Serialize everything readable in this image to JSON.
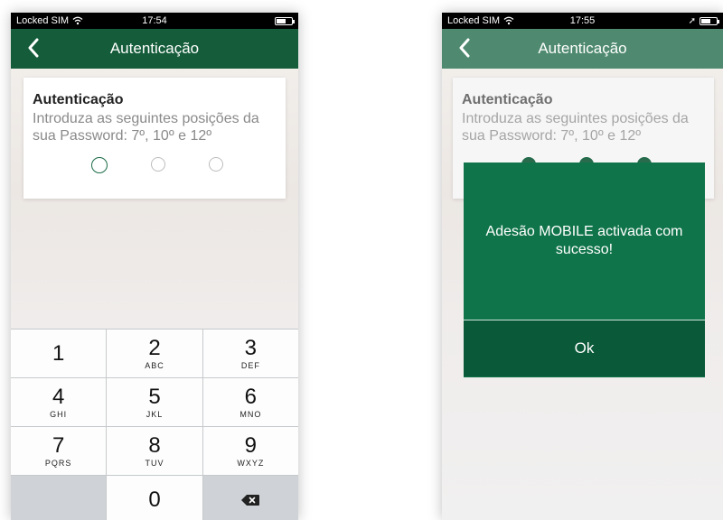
{
  "left_screen": {
    "status": {
      "carrier": "Locked SIM",
      "time": "17:54",
      "wifi_icon": "wifi-icon",
      "battery_icon": "battery-icon"
    },
    "nav": {
      "title": "Autenticação",
      "back_icon": "chevron-left-icon"
    },
    "card": {
      "title": "Autenticação",
      "text": "Introduza as seguintes posições da sua Password: 7º, 10º e 12º",
      "positions": 3,
      "active_position": 1
    },
    "keypad": {
      "keys": [
        {
          "digit": "1",
          "letters": ""
        },
        {
          "digit": "2",
          "letters": "ABC"
        },
        {
          "digit": "3",
          "letters": "DEF"
        },
        {
          "digit": "4",
          "letters": "GHI"
        },
        {
          "digit": "5",
          "letters": "JKL"
        },
        {
          "digit": "6",
          "letters": "MNO"
        },
        {
          "digit": "7",
          "letters": "PQRS"
        },
        {
          "digit": "8",
          "letters": "TUV"
        },
        {
          "digit": "9",
          "letters": "WXYZ"
        },
        {
          "digit": "",
          "letters": ""
        },
        {
          "digit": "0",
          "letters": ""
        }
      ],
      "delete_icon": "backspace-icon"
    }
  },
  "right_screen": {
    "status": {
      "carrier": "Locked SIM",
      "time": "17:55",
      "location_icon": "location-arrow-icon",
      "battery_icon": "battery-icon"
    },
    "nav": {
      "title": "Autenticação",
      "back_icon": "chevron-left-icon"
    },
    "card": {
      "title": "Autenticação",
      "text": "Introduza as seguintes posições da sua Password: 7º, 10º e 12º"
    },
    "dialog": {
      "message": "Adesão MOBILE activada com sucesso!",
      "ok_label": "Ok"
    }
  },
  "colors": {
    "nav_green": "#145c3a",
    "dialog_green": "#10744a",
    "dialog_button_green": "#0a5a39"
  }
}
